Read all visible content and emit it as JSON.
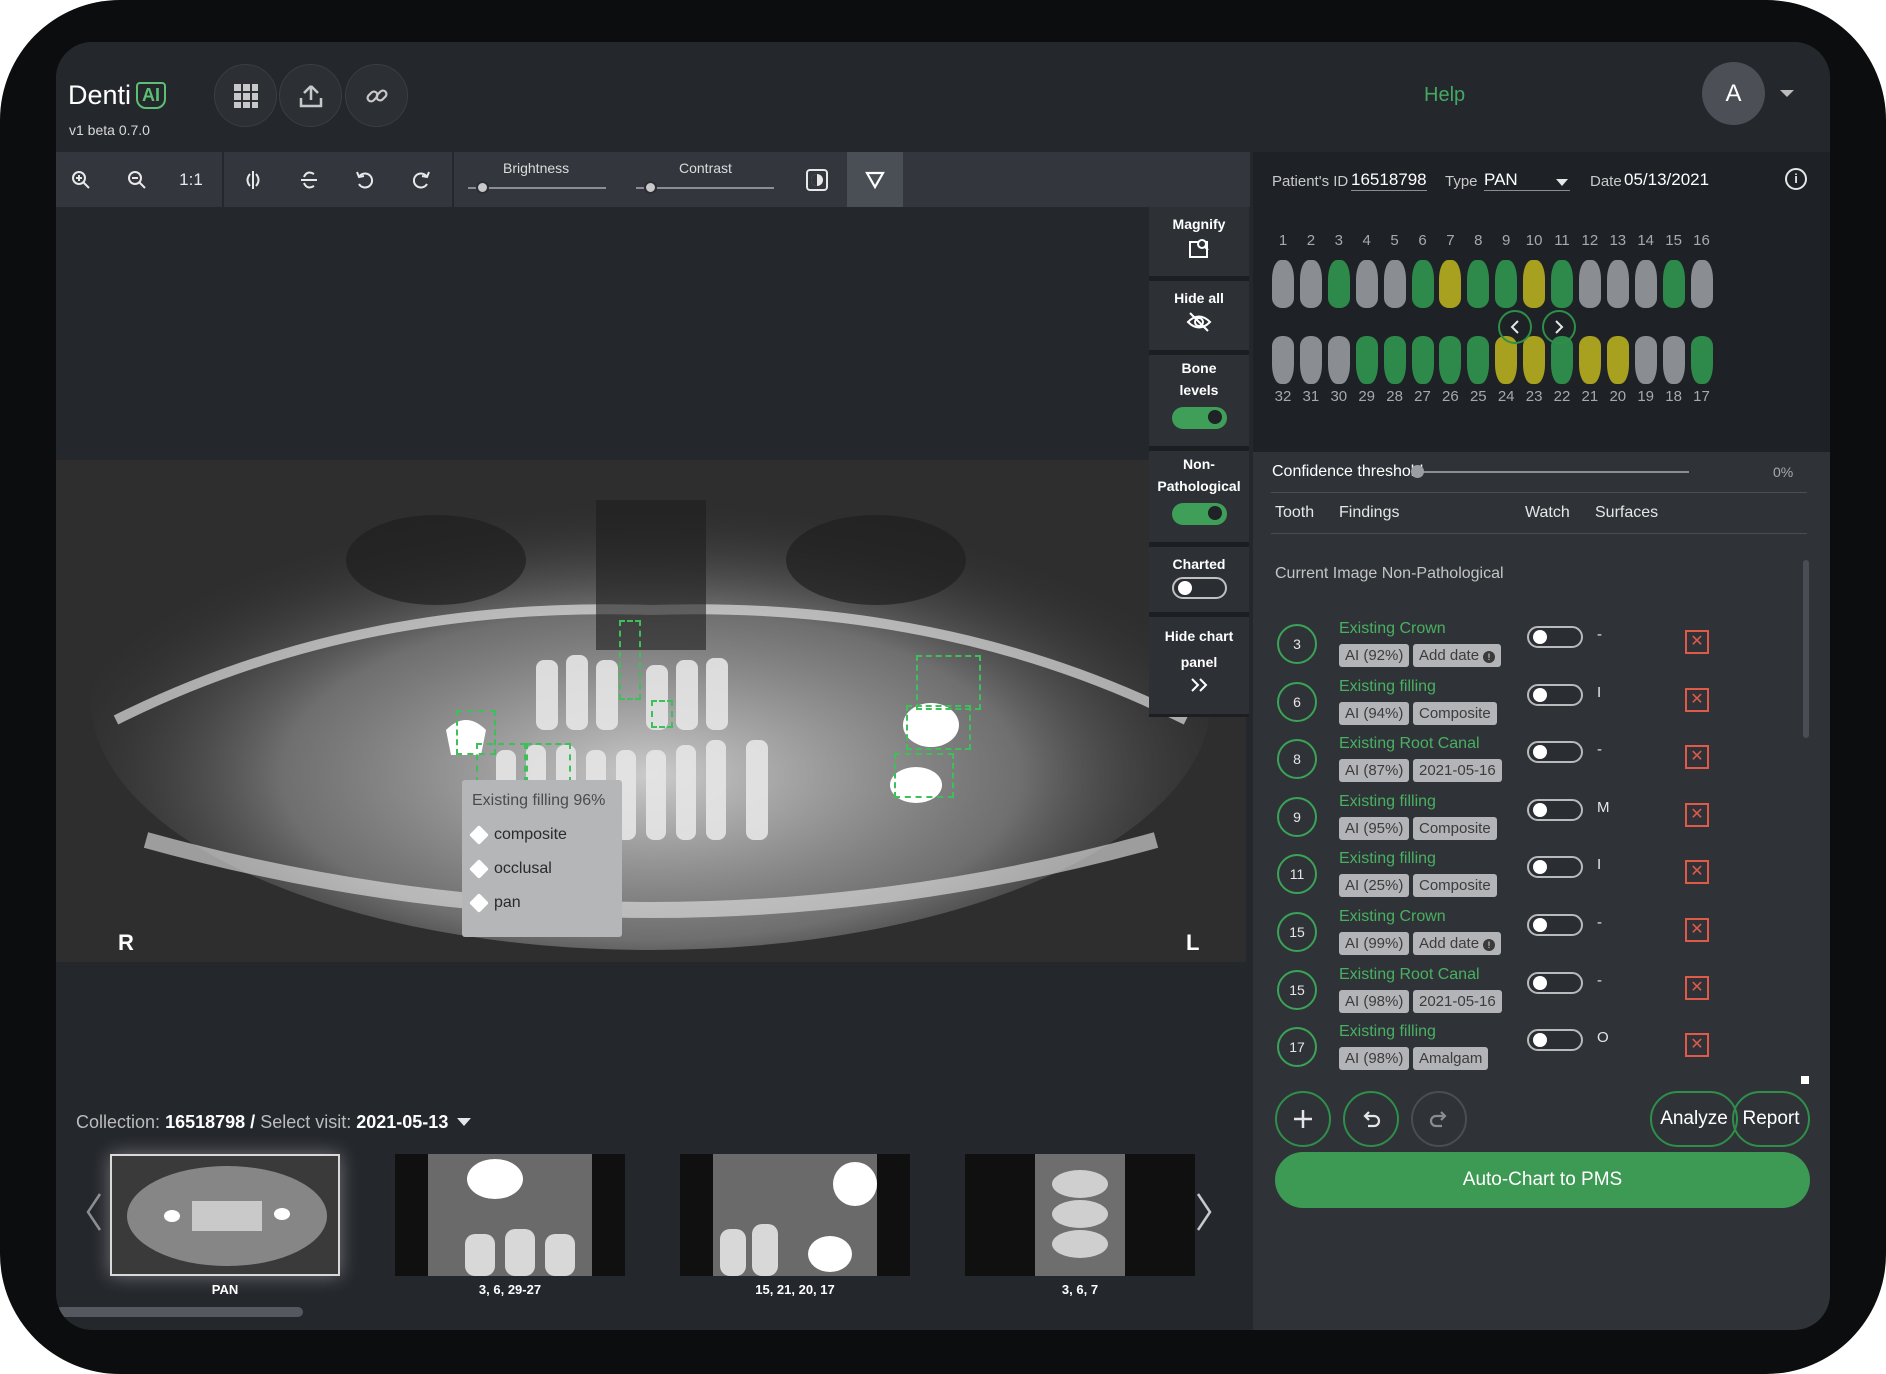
{
  "app": {
    "logo_text": "Denti",
    "logo_badge": "AI",
    "version": "v1 beta 0.7.0"
  },
  "header": {
    "help": "Help",
    "avatar_initial": "A",
    "icons": [
      "grid-icon",
      "upload-icon",
      "link-icon"
    ]
  },
  "toolbar": {
    "actual_size": "1:1",
    "brightness_label": "Brightness",
    "contrast_label": "Contrast",
    "brightness_value": 0.1,
    "contrast_value": 0.1
  },
  "viewer": {
    "left_marker": "R",
    "right_marker": "L",
    "tooltip": {
      "title": "Existing filling 96%",
      "tags": [
        "composite",
        "occlusal",
        "pan"
      ]
    }
  },
  "side_panel": {
    "magnify": "Magnify",
    "hide_all": "Hide all",
    "bone_levels": "Bone levels",
    "non_pathological": "Non-Pathological",
    "charted": "Charted",
    "hide_chart_panel": "Hide chart panel",
    "bone_levels_on": true,
    "non_pathological_on": true,
    "charted_on": false
  },
  "collection": {
    "collection_label": "Collection:",
    "collection_id": "16518798",
    "separator": "/",
    "visit_label": "Select visit:",
    "visit_value": "2021-05-13",
    "thumbnails": [
      "PAN",
      "3, 6, 29-27",
      "15, 21, 20, 17",
      "3, 6, 7"
    ]
  },
  "patient": {
    "id_label": "Patient's ID",
    "id_value": "16518798",
    "type_label": "Type",
    "type_value": "PAN",
    "date_label": "Date",
    "date_value": "05/13/2021"
  },
  "teeth": {
    "upper_numbers": [
      "1",
      "2",
      "3",
      "4",
      "5",
      "6",
      "7",
      "8",
      "9",
      "10",
      "11",
      "12",
      "13",
      "14",
      "15",
      "16"
    ],
    "lower_numbers": [
      "32",
      "31",
      "30",
      "29",
      "28",
      "27",
      "26",
      "25",
      "24",
      "23",
      "22",
      "21",
      "20",
      "19",
      "18",
      "17"
    ],
    "upper_colors": [
      "#8a8d91",
      "#8a8d91",
      "#2e8a4a",
      "#8a8d91",
      "#8a8d91",
      "#2e8a4a",
      "#a8a01f",
      "#2e8a4a",
      "#2e8a4a",
      "#a8a01f",
      "#2e8a4a",
      "#8a8d91",
      "#8a8d91",
      "#8a8d91",
      "#2e8a4a",
      "#8a8d91"
    ],
    "lower_colors": [
      "#8a8d91",
      "#8a8d91",
      "#8a8d91",
      "#2e8a4a",
      "#2e8a4a",
      "#2e8a4a",
      "#2e8a4a",
      "#2e8a4a",
      "#a8a01f",
      "#a8a01f",
      "#2e8a4a",
      "#a8a01f",
      "#a8a01f",
      "#8a8d91",
      "#8a8d91",
      "#2e8a4a"
    ]
  },
  "findings_panel": {
    "confidence_label": "Confidence threshold",
    "confidence_value": "0%",
    "col_tooth": "Tooth",
    "col_findings": "Findings",
    "col_watch": "Watch",
    "col_surfaces": "Surfaces",
    "section_title": "Current Image Non-Pathological",
    "rows": [
      {
        "tooth": "3",
        "finding": "Existing Crown",
        "ai": "AI (92%)",
        "detail": "Add date",
        "surface": "-",
        "info": true
      },
      {
        "tooth": "6",
        "finding": "Existing filling",
        "ai": "AI (94%)",
        "detail": "Composite",
        "surface": "I",
        "info": false
      },
      {
        "tooth": "8",
        "finding": "Existing Root Canal",
        "ai": "AI (87%)",
        "detail": "2021-05-16",
        "surface": "-",
        "info": false
      },
      {
        "tooth": "9",
        "finding": "Existing filling",
        "ai": "AI (95%)",
        "detail": "Composite",
        "surface": "M",
        "info": false
      },
      {
        "tooth": "11",
        "finding": "Existing filling",
        "ai": "AI (25%)",
        "detail": "Composite",
        "surface": "I",
        "info": false
      },
      {
        "tooth": "15",
        "finding": "Existing Crown",
        "ai": "AI (99%)",
        "detail": "Add date",
        "surface": "-",
        "info": true
      },
      {
        "tooth": "15",
        "finding": "Existing Root Canal",
        "ai": "AI (98%)",
        "detail": "2021-05-16",
        "surface": "-",
        "info": false
      },
      {
        "tooth": "17",
        "finding": "Existing filling",
        "ai": "AI (98%)",
        "detail": "Amalgam",
        "surface": "O",
        "info": false
      }
    ],
    "analyze": "Analyze",
    "report": "Report",
    "auto_chart": "Auto-Chart to PMS"
  },
  "colors": {
    "accent": "#3d9a54",
    "link": "#45a862",
    "delete": "#e05a4a",
    "background": "#24272c"
  }
}
